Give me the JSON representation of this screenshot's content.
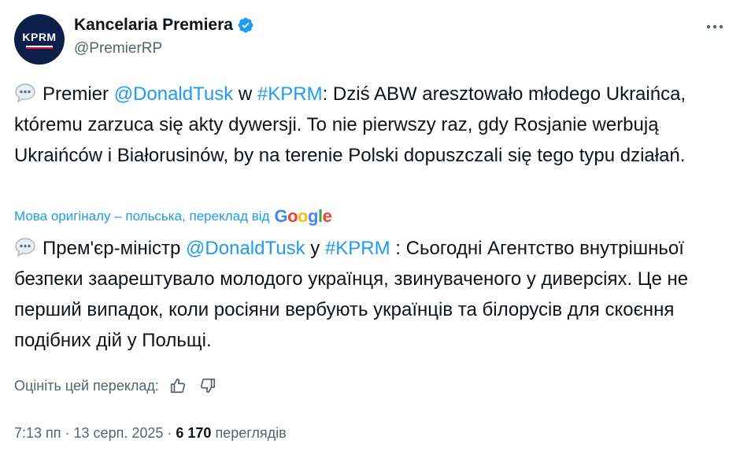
{
  "account": {
    "avatar_text": "KPRM",
    "display_name": "Kancelaria Premiera",
    "handle": "@PremierRP"
  },
  "tweet": {
    "orig_part1": "Premier ",
    "orig_mention": "@DonaldTusk",
    "orig_part2": " w ",
    "orig_hashtag": "#KPRM",
    "orig_part3": ": Dziś ABW aresztowało młodego Ukraińca, któremu zarzuca się akty dywersji. To nie pierwszy raz, gdy Rosjanie werbują Ukraińców i Białorusinów, by na terenie Polski dopuszczali się tego typu działań.",
    "translated_by_label": "Мова оригіналу – польська, переклад від",
    "translator": "Google",
    "trans_part1": "Прем'єр-міністр ",
    "trans_mention": "@DonaldTusk",
    "trans_part2": " у ",
    "trans_hashtag": "#KPRM",
    "trans_part3": " : Сьогодні Агентство внутрішньої безпеки заарештувало молодого українця, звинуваченого у диверсіях. Це не перший випадок, коли росіяни вербують українців та білорусів для скоєння подібних дій у Польщі.",
    "rate_label": "Оцініть цей переклад:"
  },
  "meta": {
    "time": "7:13 пп",
    "separator": " · ",
    "date": "13 серп. 2025",
    "views_count": "6 170",
    "views_label": "переглядів"
  },
  "icons": {
    "verified": "verified-badge-icon",
    "more": "more-options-icon",
    "speech": "speech-balloon-icon",
    "thumbs_up": "thumbs-up-icon",
    "thumbs_down": "thumbs-down-icon"
  },
  "colors": {
    "link": "#1d9bf0",
    "secondary_text": "#536471",
    "primary_text": "#0f1419",
    "avatar_bg": "#0b1f4a"
  }
}
